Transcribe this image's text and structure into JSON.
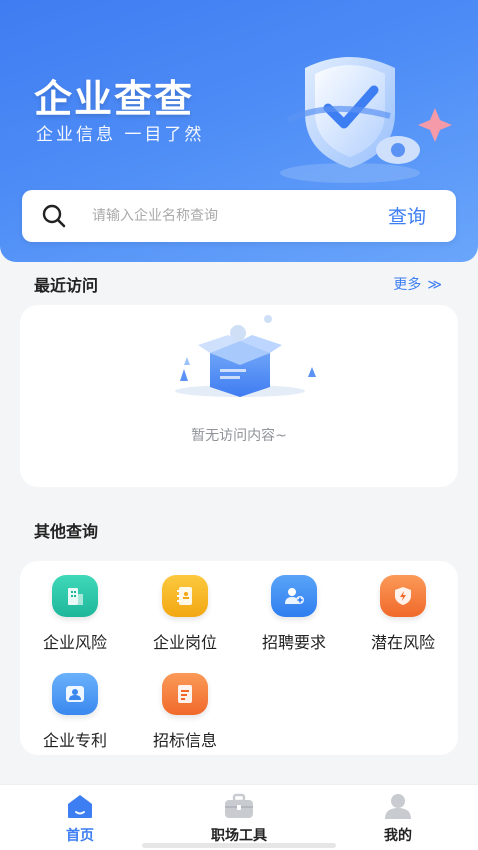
{
  "header": {
    "title": "企业查查",
    "subtitle": "企业信息 一目了然",
    "illustration": "shield-check-icon"
  },
  "search": {
    "placeholder": "请输入企业名称查询",
    "button_label": "查询"
  },
  "recent": {
    "title": "最近访问",
    "more_label": "更多",
    "empty_text": "暂无访问内容~"
  },
  "other": {
    "title": "其他查询",
    "items": [
      {
        "label": "企业风险",
        "icon": "building-icon",
        "color": "#2ec6a8"
      },
      {
        "label": "企业岗位",
        "icon": "notebook-icon",
        "color": "#f5b72a"
      },
      {
        "label": "招聘要求",
        "icon": "user-add-icon",
        "color": "#3f8ef5"
      },
      {
        "label": "潜在风险",
        "icon": "shield-bolt-icon",
        "color": "#f5803e"
      },
      {
        "label": "企业专利",
        "icon": "user-card-icon",
        "color": "#4b9bf3"
      },
      {
        "label": "招标信息",
        "icon": "document-icon",
        "color": "#f5803e"
      }
    ]
  },
  "tabbar": {
    "items": [
      {
        "label": "首页",
        "icon": "home-icon",
        "active": true
      },
      {
        "label": "职场工具",
        "icon": "briefcase-icon",
        "active": false
      },
      {
        "label": "我的",
        "icon": "profile-icon",
        "active": false
      }
    ]
  },
  "colors": {
    "accent": "#3d7ef2",
    "hero_start": "#3f7cf2",
    "hero_end": "#6aa6fb"
  }
}
